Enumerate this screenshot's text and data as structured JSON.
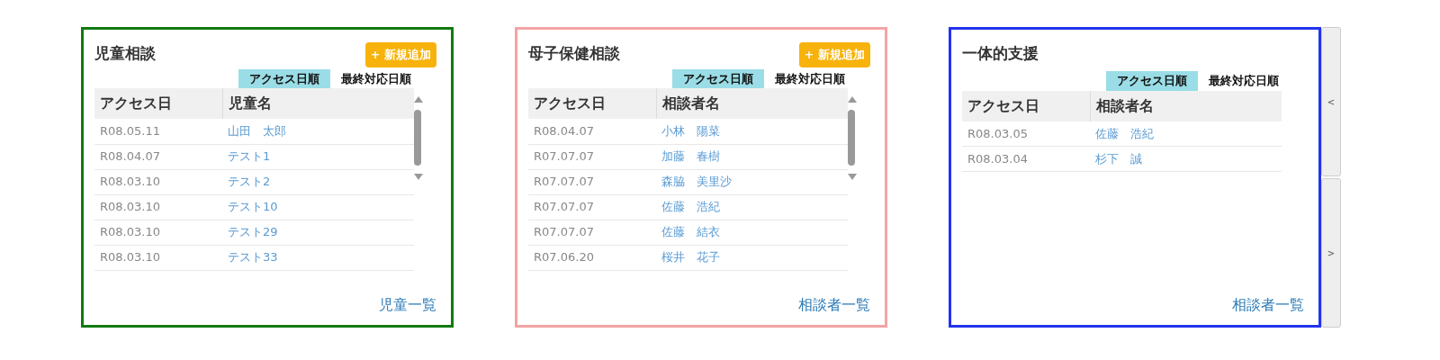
{
  "panels": [
    {
      "title": "児童相談",
      "color": "#117a11",
      "add_button": "+ 新規追加",
      "sort_tabs": [
        {
          "label": "アクセス日順",
          "selected": true
        },
        {
          "label": "最終対応日順",
          "selected": false
        }
      ],
      "columns": [
        "アクセス日",
        "児童名"
      ],
      "scrollable": true,
      "rows": [
        {
          "date": "R08.05.11",
          "name": "山田　太郎"
        },
        {
          "date": "R08.04.07",
          "name": "テスト1"
        },
        {
          "date": "R08.03.10",
          "name": "テスト2"
        },
        {
          "date": "R08.03.10",
          "name": "テスト10"
        },
        {
          "date": "R08.03.10",
          "name": "テスト29"
        },
        {
          "date": "R08.03.10",
          "name": "テスト33"
        }
      ],
      "footer_link": "児童一覧"
    },
    {
      "title": "母子保健相談",
      "color": "#f4a3a3",
      "add_button": "+ 新規追加",
      "sort_tabs": [
        {
          "label": "アクセス日順",
          "selected": true
        },
        {
          "label": "最終対応日順",
          "selected": false
        }
      ],
      "columns": [
        "アクセス日",
        "相談者名"
      ],
      "scrollable": true,
      "rows": [
        {
          "date": "R08.04.07",
          "name": "小林　陽菜"
        },
        {
          "date": "R07.07.07",
          "name": "加藤　春樹"
        },
        {
          "date": "R07.07.07",
          "name": "森脇　美里沙"
        },
        {
          "date": "R07.07.07",
          "name": "佐藤　浩紀"
        },
        {
          "date": "R07.07.07",
          "name": "佐藤　結衣"
        },
        {
          "date": "R07.06.20",
          "name": "桜井　花子"
        }
      ],
      "footer_link": "相談者一覧"
    },
    {
      "title": "一体的支援",
      "color": "#2233ee",
      "sort_tabs": [
        {
          "label": "アクセス日順",
          "selected": true
        },
        {
          "label": "最終対応日順",
          "selected": false
        }
      ],
      "columns": [
        "アクセス日",
        "相談者名"
      ],
      "scrollable": false,
      "rows": [
        {
          "date": "R08.03.05",
          "name": "佐藤　浩紀"
        },
        {
          "date": "R08.03.04",
          "name": "杉下　誠"
        }
      ],
      "footer_link": "相談者一覧"
    }
  ],
  "pager": {
    "prev": "<",
    "next": ">"
  }
}
